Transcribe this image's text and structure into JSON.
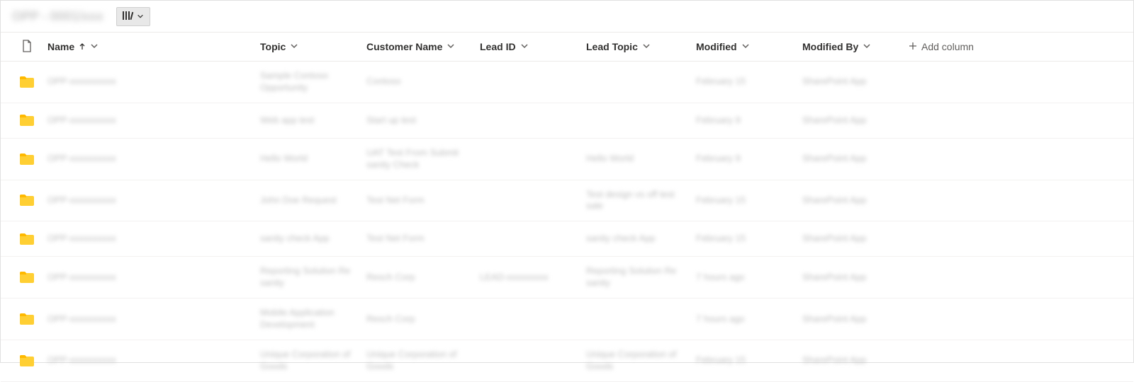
{
  "toolbar": {
    "title": "OPP - 0001/xxx"
  },
  "columns": {
    "name": "Name",
    "topic": "Topic",
    "customer": "Customer Name",
    "leadid": "Lead ID",
    "leadtopic": "Lead Topic",
    "modified": "Modified",
    "modifiedby": "Modified By",
    "addcolumn": "Add column"
  },
  "rows": [
    {
      "name": "OPP-xxxxxxxxxx",
      "topic": "Sample Contoso Opportunity",
      "customer": "Contoso",
      "leadid": "",
      "leadtopic": "",
      "modified": "February 15",
      "modifiedby": "SharePoint App"
    },
    {
      "name": "OPP-xxxxxxxxxx",
      "topic": "Web app test",
      "customer": "Start up test",
      "leadid": "",
      "leadtopic": "",
      "modified": "February 9",
      "modifiedby": "SharePoint App"
    },
    {
      "name": "OPP-xxxxxxxxxx",
      "topic": "Hello World",
      "customer": "UAT Test From Submit sanity Check",
      "leadid": "",
      "leadtopic": "Hello World",
      "modified": "February 9",
      "modifiedby": "SharePoint App"
    },
    {
      "name": "OPP-xxxxxxxxxx",
      "topic": "John Doe Request",
      "customer": "Test Net Form",
      "leadid": "",
      "leadtopic": "Test design vs off test sale",
      "modified": "February 15",
      "modifiedby": "SharePoint App"
    },
    {
      "name": "OPP-xxxxxxxxxx",
      "topic": "sanity check App",
      "customer": "Test Net Form",
      "leadid": "",
      "leadtopic": "sanity check App",
      "modified": "February 15",
      "modifiedby": "SharePoint App"
    },
    {
      "name": "OPP-xxxxxxxxxx",
      "topic": "Reporting Solution Re sanity",
      "customer": "Resch Corp",
      "leadid": "LEAD-xxxxxxxxx",
      "leadtopic": "Reporting Solution Re sanity",
      "modified": "7 hours ago",
      "modifiedby": "SharePoint App"
    },
    {
      "name": "OPP-xxxxxxxxxx",
      "topic": "Mobile Application Development",
      "customer": "Resch Corp",
      "leadid": "",
      "leadtopic": "",
      "modified": "7 hours ago",
      "modifiedby": "SharePoint App"
    },
    {
      "name": "OPP-xxxxxxxxxx",
      "topic": "Unique Corporation of Goods",
      "customer": "Unique Corporation of Goods",
      "leadid": "",
      "leadtopic": "Unique Corporation of Goods",
      "modified": "February 15",
      "modifiedby": "SharePoint App"
    }
  ]
}
